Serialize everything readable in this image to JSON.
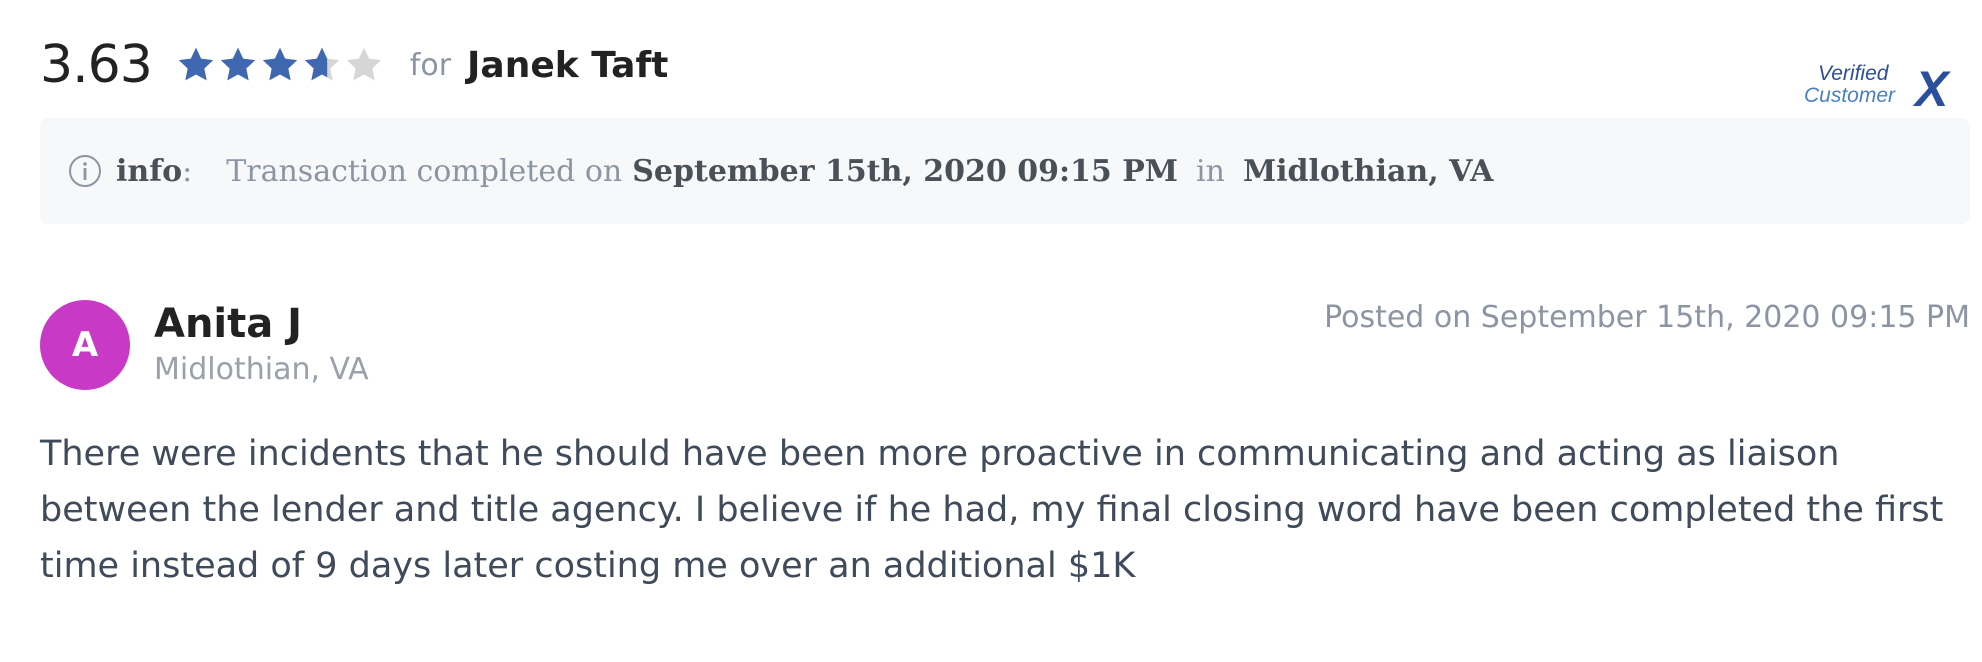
{
  "rating": {
    "value": "3.63",
    "score": 3.63,
    "max": 5,
    "star_color": "#3f68b0",
    "empty_star_color": "#d6d6d6"
  },
  "header": {
    "for_label": "for",
    "agent_name": "Janek Taft"
  },
  "badge": {
    "line1": "Verified",
    "line2": "Customer",
    "mark": "X"
  },
  "info": {
    "icon": "info-circle-icon",
    "label": "info",
    "colon": ":",
    "transaction_prefix": "Transaction completed on",
    "transaction_date": "September 15th, 2020 09:15 PM",
    "in_label": "in",
    "location": "Midlothian, VA"
  },
  "review": {
    "avatar_letter": "A",
    "avatar_color": "#c83ac6",
    "reviewer_name": "Anita J",
    "reviewer_location": "Midlothian, VA",
    "posted": "Posted on September 15th, 2020 09:15 PM",
    "text": "There were incidents that he should have been more proactive in communicating  and acting as liaison between the lender and title agency. I believe if he had, my final closing word have been completed the first time instead of 9 days later costing me over an additional $1K"
  }
}
